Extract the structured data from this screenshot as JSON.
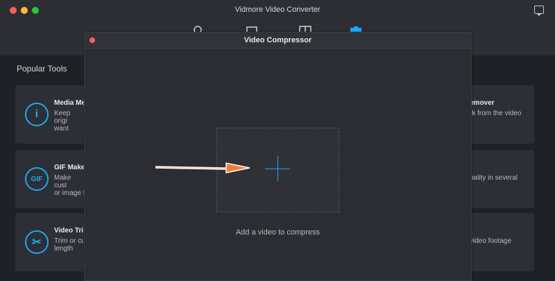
{
  "app": {
    "title": "Vidmore Video Converter"
  },
  "nav": {
    "items": [
      "converter-icon",
      "mv-icon",
      "collage-icon",
      "toolbox-icon"
    ]
  },
  "sidebar": {
    "section_title": "Popular Tools"
  },
  "cards": [
    {
      "left_title": "Media Me",
      "left_desc": "Keep origi\nwant",
      "right_title": "emover",
      "right_desc": "rk from the video"
    },
    {
      "left_title": "GIF Make",
      "left_desc": "Make cust\nor image f",
      "right_title": "",
      "right_desc": "uality in several"
    },
    {
      "left_title": "Video Tri",
      "left_desc": "Trim or cu\nlength",
      "right_title": "",
      "right_desc": "video footage"
    }
  ],
  "dialog": {
    "title": "Video Compressor",
    "caption": "Add a video to compress"
  },
  "colors": {
    "accent": "#1ea7f5",
    "arrow": "#f47b3f"
  }
}
